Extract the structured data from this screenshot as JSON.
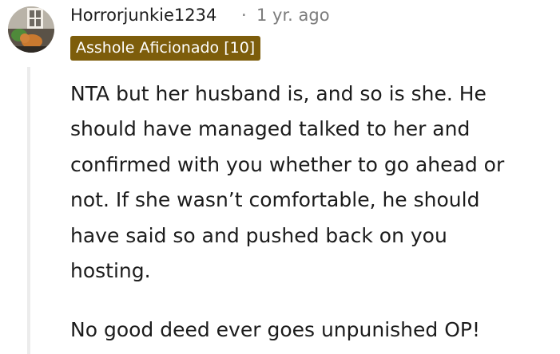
{
  "comment": {
    "author": "Horrorjunkie1234",
    "separator": "·",
    "timestamp": "1 yr. ago",
    "flair": "Asshole Aficionado [10]",
    "paragraphs": [
      "NTA but her husband is, and so is she. He\nshould have managed talked to her and\nconfirmed with you whether to go ahead or\nnot. If she wasn’t comfortable, he should\nhave said so and pushed back on you\nhosting.",
      "No good deed ever goes unpunished OP!"
    ]
  },
  "colors": {
    "flair_background": "#7d5d0b",
    "meta_text": "#7c7c7c",
    "thread_line": "#ececec"
  },
  "icons": {
    "avatar": "user-avatar-cat-photo"
  }
}
